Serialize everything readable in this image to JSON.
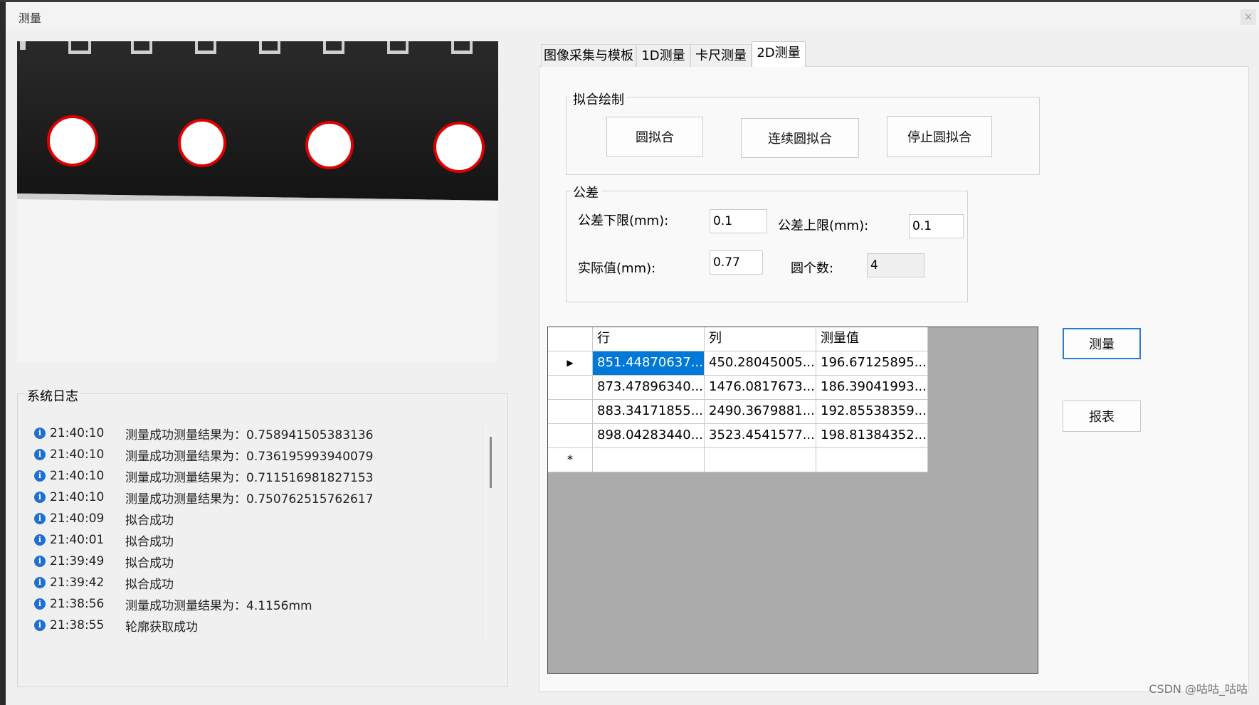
{
  "window": {
    "title": "测量",
    "close_glyph": "×"
  },
  "image": {
    "description_icon": "camera-view"
  },
  "log": {
    "title": "系统日志",
    "entries": [
      {
        "time": "21:40:10",
        "message": "测量成功测量结果为：0.758941505383136"
      },
      {
        "time": "21:40:10",
        "message": "测量成功测量结果为：0.736195993940079"
      },
      {
        "time": "21:40:10",
        "message": "测量成功测量结果为：0.711516981827153"
      },
      {
        "time": "21:40:10",
        "message": "测量成功测量结果为：0.750762515762617"
      },
      {
        "time": "21:40:09",
        "message": "拟合成功"
      },
      {
        "time": "21:40:01",
        "message": "拟合成功"
      },
      {
        "time": "21:39:49",
        "message": "拟合成功"
      },
      {
        "time": "21:39:42",
        "message": "拟合成功"
      },
      {
        "time": "21:38:56",
        "message": "测量成功测量结果为：4.1156mm"
      },
      {
        "time": "21:38:55",
        "message": "轮廓获取成功"
      }
    ]
  },
  "tabs": [
    {
      "label": "图像采集与模板"
    },
    {
      "label": "1D测量"
    },
    {
      "label": "卡尺测量"
    },
    {
      "label": "2D测量"
    }
  ],
  "fit_group": {
    "title": "拟合绘制",
    "circle_fit": "圆拟合",
    "continuous_fit": "连续圆拟合",
    "stop_fit": "停止圆拟合"
  },
  "tolerance_group": {
    "title": "公差",
    "lower_label": "公差下限(mm):",
    "lower_value": "0.1",
    "upper_label": "公差上限(mm):",
    "upper_value": "0.1",
    "actual_label": "实际值(mm):",
    "actual_value": "0.77",
    "count_label": "圆个数:",
    "count_value": "4"
  },
  "grid": {
    "columns": [
      "行",
      "列",
      "测量值"
    ],
    "rows": [
      [
        "851.44870637...",
        "450.28045005...",
        "196.67125895..."
      ],
      [
        "873.47896340...",
        "1476.0817673...",
        "186.39041993..."
      ],
      [
        "883.34171855...",
        "2490.3679881...",
        "192.85538359..."
      ],
      [
        "898.04283440...",
        "3523.4541577...",
        "198.81384352..."
      ]
    ],
    "current_marker": "▶",
    "new_marker": "*"
  },
  "actions": {
    "measure": "测量",
    "report": "报表"
  },
  "watermark": "CSDN @咕咕_咕咕",
  "colors": {
    "selection": "#0078d7",
    "fit_circle": "#e00000",
    "info_icon": "#1e6fd0"
  }
}
